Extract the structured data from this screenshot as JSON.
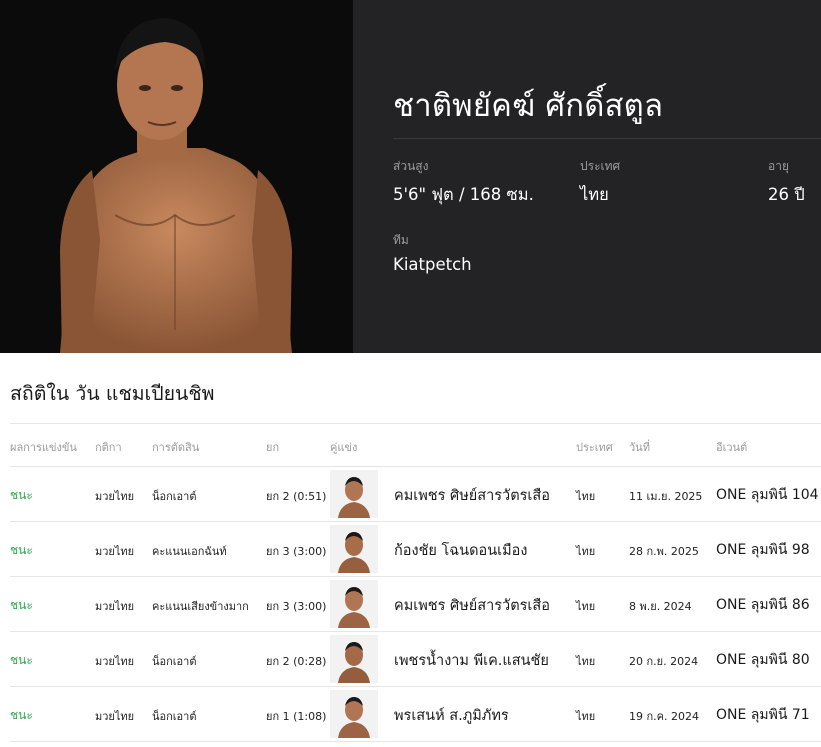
{
  "athlete": {
    "name": "ชาติพยัคฆ์ ศักดิ์สตูล",
    "height_label": "ส่วนสูง",
    "height_value": "5'6\" ฟุต / 168 ซม.",
    "country_label": "ประเทศ",
    "country_value": "ไทย",
    "age_label": "อายุ",
    "age_value": "26 ปี",
    "team_label": "ทีม",
    "team_value": "Kiatpetch"
  },
  "stats": {
    "title": "สถิติใน วัน แชมเปียนชิพ",
    "headers": {
      "result": "ผลการแข่งขัน",
      "rule": "กติกา",
      "method": "การตัดสิน",
      "round": "ยก",
      "opponent": "คู่แข่ง",
      "country": "ประเทศ",
      "date": "วันที่",
      "event": "อีเวนต์"
    },
    "rows": [
      {
        "result": "ชนะ",
        "rule": "มวยไทย",
        "method": "น็อกเอาต์",
        "round": "ยก 2 (0:51)",
        "opponent": "คมเพชร ศิษย์สารวัตรเสือ",
        "country": "ไทย",
        "date": "11 เม.ย. 2025",
        "event": "ONE ลุมพินี 104"
      },
      {
        "result": "ชนะ",
        "rule": "มวยไทย",
        "method": "คะแนนเอกฉันท์",
        "round": "ยก 3 (3:00)",
        "opponent": "ก้องชัย โฉนดอนเมือง",
        "country": "ไทย",
        "date": "28 ก.พ. 2025",
        "event": "ONE ลุมพินี 98"
      },
      {
        "result": "ชนะ",
        "rule": "มวยไทย",
        "method": "คะแนนเสียงข้างมาก",
        "round": "ยก 3 (3:00)",
        "opponent": "คมเพชร ศิษย์สารวัตรเสือ",
        "country": "ไทย",
        "date": "8 พ.ย. 2024",
        "event": "ONE ลุมพินี 86"
      },
      {
        "result": "ชนะ",
        "rule": "มวยไทย",
        "method": "น็อกเอาต์",
        "round": "ยก 2 (0:28)",
        "opponent": "เพชรน้ำงาม พีเค.แสนชัย",
        "country": "ไทย",
        "date": "20 ก.ย. 2024",
        "event": "ONE ลุมพินี 80"
      },
      {
        "result": "ชนะ",
        "rule": "มวยไทย",
        "method": "น็อกเอาต์",
        "round": "ยก 1 (1:08)",
        "opponent": "พรเสนห์ ส.ภูมิภัทร",
        "country": "ไทย",
        "date": "19 ก.ค. 2024",
        "event": "ONE ลุมพินี 71"
      }
    ]
  }
}
